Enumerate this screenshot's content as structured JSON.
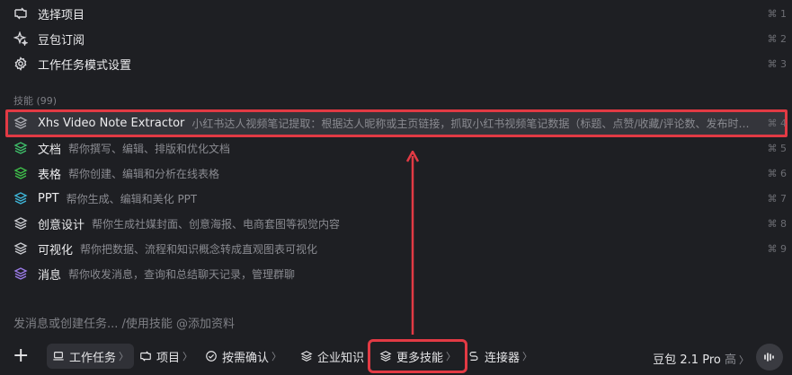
{
  "top_items": [
    {
      "label": "选择项目",
      "shortcut": "⌘ 1"
    },
    {
      "label": "豆包订阅",
      "shortcut": "⌘ 2"
    },
    {
      "label": "工作任务模式设置",
      "shortcut": "⌘ 3"
    }
  ],
  "skills_section": {
    "title": "技能",
    "count": "(99)"
  },
  "skills": [
    {
      "name": "Xhs Video Note Extractor",
      "desc": "小红书达人视频笔记提取：根据达人昵称或主页链接，抓取小红书视频笔记数据（标题、点赞/收藏/评论数、发布时间...",
      "shortcut": "⌘ 4",
      "icon_color": "#a9aab0"
    },
    {
      "name": "文档",
      "desc": "帮你撰写、编辑、排版和优化文档",
      "shortcut": "⌘ 5",
      "icon_color": "#3fbf6a"
    },
    {
      "name": "表格",
      "desc": "帮你创建、编辑和分析在线表格",
      "shortcut": "⌘ 6",
      "icon_color": "#3fbf4a"
    },
    {
      "name": "PPT",
      "desc": "帮你生成、编辑和美化 PPT",
      "shortcut": "⌘ 7",
      "icon_color": "#3fb6d9"
    },
    {
      "name": "创意设计",
      "desc": "帮你生成社媒封面、创意海报、电商套图等视觉内容",
      "shortcut": "⌘ 8",
      "icon_color": "#c9cacf"
    },
    {
      "name": "可视化",
      "desc": "帮你把数据、流程和知识概念转成直观图表可视化",
      "shortcut": "⌘ 9",
      "icon_color": "#c9cacf"
    },
    {
      "name": "消息",
      "desc": "帮你收发消息，查询和总结聊天记录，管理群聊",
      "shortcut": "",
      "icon_color": "#9b7be8"
    }
  ],
  "input": {
    "placeholder": "发消息或创建任务... /使用技能 @添加资料"
  },
  "bottombar": {
    "plus": "+",
    "task": "工作任务",
    "project": "项目",
    "confirm": "按需确认",
    "knowledge": "企业知识",
    "more_skills": "更多技能",
    "connector": "连接器",
    "model": "豆包 2.1 Pro",
    "model_tier": "高"
  },
  "colors": {
    "highlight": "#e23a44",
    "background": "#1e1f23"
  }
}
